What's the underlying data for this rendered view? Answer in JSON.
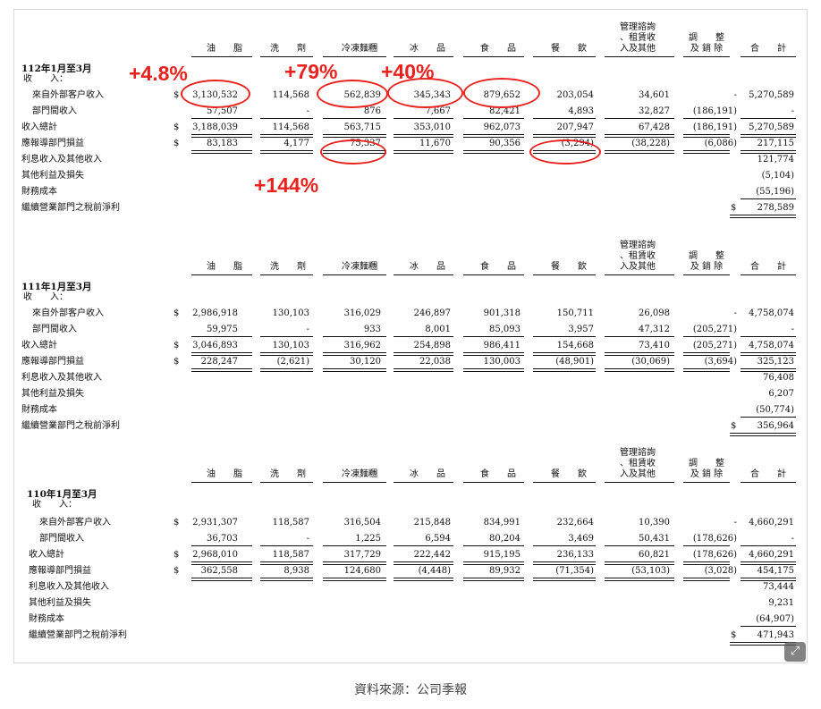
{
  "columns": [
    "油　　脂",
    "洗　　劑",
    "冷凍麵糰",
    "冰　　品",
    "食　　品",
    "餐　　飲",
    "管理諮詢\n、租賃收\n入及其他",
    "調　　整\n及 銷 除",
    "合　　計"
  ],
  "sections": [
    {
      "period": "112年1月至3月",
      "revenue_label": "收　　入：",
      "rows": [
        {
          "label": "來自外部客户收入",
          "dollar": "$",
          "values": [
            "3,130,532",
            "114,568",
            "562,839",
            "345,343",
            "879,652",
            "203,054",
            "34,601",
            "-",
            "5,270,589"
          ]
        },
        {
          "label": "部門間收入",
          "values": [
            "57,507",
            "-",
            "876",
            "7,667",
            "82,421",
            "4,893",
            "32,827",
            "(186,191)",
            "-"
          ]
        },
        {
          "label": "收入總計",
          "dollar": "$",
          "values": [
            "3,188,039",
            "114,568",
            "563,715",
            "353,010",
            "962,073",
            "207,947",
            "67,428",
            "(186,191)",
            "5,270,589"
          ]
        },
        {
          "label": "應報導部門損益",
          "dollar": "$",
          "values": [
            "83,183",
            "4,177",
            "75,337",
            "11,670",
            "90,356",
            "(3,294)",
            "(38,228)",
            "(6,086)",
            "217,115"
          ]
        },
        {
          "label": "利息收入及其他收入",
          "values": [
            "",
            "",
            "",
            "",
            "",
            "",
            "",
            "",
            "121,774"
          ]
        },
        {
          "label": "其他利益及損失",
          "values": [
            "",
            "",
            "",
            "",
            "",
            "",
            "",
            "",
            "(5,104)"
          ]
        },
        {
          "label": "財務成本",
          "values": [
            "",
            "",
            "",
            "",
            "",
            "",
            "",
            "",
            "(55,196)"
          ]
        },
        {
          "label": "繼續營業部門之稅前淨利",
          "dollar_total": "$",
          "values": [
            "",
            "",
            "",
            "",
            "",
            "",
            "",
            "",
            "278,589"
          ]
        }
      ]
    },
    {
      "period": "111年1月至3月",
      "revenue_label": "收　　入：",
      "rows": [
        {
          "label": "來自外部客户收入",
          "dollar": "$",
          "values": [
            "2,986,918",
            "130,103",
            "316,029",
            "246,897",
            "901,318",
            "150,711",
            "26,098",
            "-",
            "4,758,074"
          ]
        },
        {
          "label": "部門間收入",
          "values": [
            "59,975",
            "-",
            "933",
            "8,001",
            "85,093",
            "3,957",
            "47,312",
            "(205,271)",
            "-"
          ]
        },
        {
          "label": "收入總計",
          "dollar": "$",
          "values": [
            "3,046,893",
            "130,103",
            "316,962",
            "254,898",
            "986,411",
            "154,668",
            "73,410",
            "(205,271)",
            "4,758,074"
          ]
        },
        {
          "label": "應報導部門損益",
          "dollar": "$",
          "values": [
            "228,247",
            "(2,621)",
            "30,120",
            "22,038",
            "130,003",
            "(48,901)",
            "(30,069)",
            "(3,694)",
            "325,123"
          ]
        },
        {
          "label": "利息收入及其他收入",
          "values": [
            "",
            "",
            "",
            "",
            "",
            "",
            "",
            "",
            "76,408"
          ]
        },
        {
          "label": "其他利益及損失",
          "values": [
            "",
            "",
            "",
            "",
            "",
            "",
            "",
            "",
            "6,207"
          ]
        },
        {
          "label": "財務成本",
          "values": [
            "",
            "",
            "",
            "",
            "",
            "",
            "",
            "",
            "(50,774)"
          ]
        },
        {
          "label": "繼續營業部門之稅前淨利",
          "dollar_total": "$",
          "values": [
            "",
            "",
            "",
            "",
            "",
            "",
            "",
            "",
            "356,964"
          ]
        }
      ]
    },
    {
      "period": "110年1月至3月",
      "revenue_label": "收　　入：",
      "rows": [
        {
          "label": "來自外部客户收入",
          "dollar": "$",
          "values": [
            "2,931,307",
            "118,587",
            "316,504",
            "215,848",
            "834,991",
            "232,664",
            "10,390",
            "-",
            "4,660,291"
          ]
        },
        {
          "label": "部門間收入",
          "values": [
            "36,703",
            "-",
            "1,225",
            "6,594",
            "80,204",
            "3,469",
            "50,431",
            "(178,626)",
            "-"
          ]
        },
        {
          "label": "收入總計",
          "dollar": "$",
          "values": [
            "2,968,010",
            "118,587",
            "317,729",
            "222,442",
            "915,195",
            "236,133",
            "60,821",
            "(178,626)",
            "4,660,291"
          ]
        },
        {
          "label": "應報導部門損益",
          "dollar": "$",
          "values": [
            "362,558",
            "8,938",
            "124,680",
            "(4,448)",
            "89,932",
            "(71,354)",
            "(53,103)",
            "(3,028)",
            "454,175"
          ]
        },
        {
          "label": "利息收入及其他收入",
          "values": [
            "",
            "",
            "",
            "",
            "",
            "",
            "",
            "",
            "73,444"
          ]
        },
        {
          "label": "其他利益及損失",
          "values": [
            "",
            "",
            "",
            "",
            "",
            "",
            "",
            "",
            "9,231"
          ]
        },
        {
          "label": "財務成本",
          "values": [
            "",
            "",
            "",
            "",
            "",
            "",
            "",
            "",
            "(64,907)"
          ]
        },
        {
          "label": "繼續營業部門之稅前淨利",
          "dollar_total": "$",
          "values": [
            "",
            "",
            "",
            "",
            "",
            "",
            "",
            "",
            "471,943"
          ]
        }
      ]
    }
  ],
  "annotations": [
    "+4.8%",
    "+79%",
    "+40%",
    "+144%"
  ],
  "annotation_color": "#e8231f",
  "caption": "資料來源：公司季報",
  "expand_icon": "expand-icon"
}
